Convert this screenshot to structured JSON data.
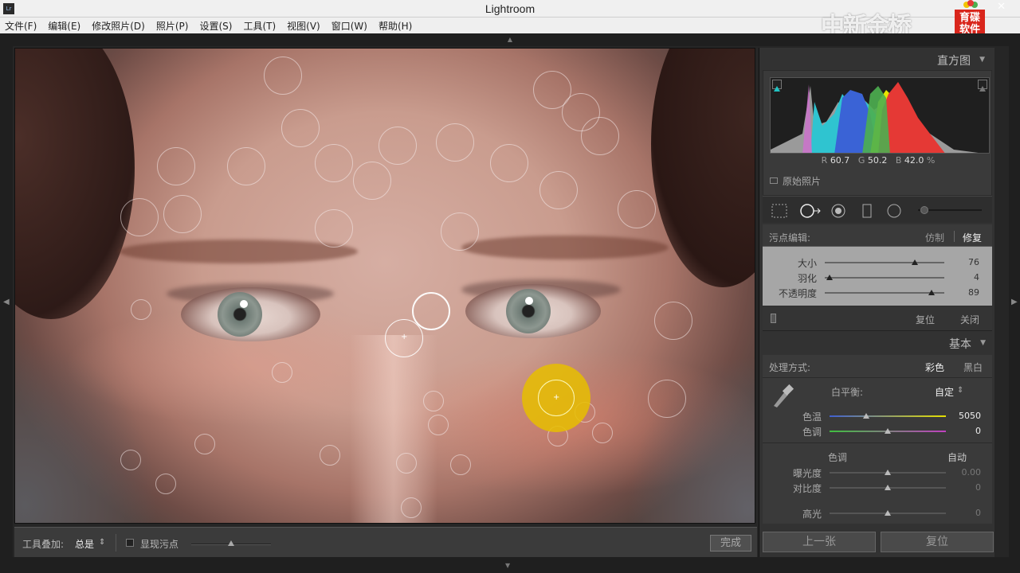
{
  "window": {
    "title": "Lightroom",
    "logo_text": "Lr",
    "close_glyph": "✕"
  },
  "menu": [
    "文件(F)",
    "编辑(E)",
    "修改照片(D)",
    "照片(P)",
    "设置(S)",
    "工具(T)",
    "视图(V)",
    "窗口(W)",
    "帮助(H)"
  ],
  "watermark": {
    "text": "中新金桥",
    "badge": "育碟软件"
  },
  "toolbar": {
    "overlay_label": "工具叠加:",
    "overlay_value": "总是",
    "overlay_arrow": "⇕",
    "show_spots_label": "显现污点",
    "done_label": "完成"
  },
  "histogram": {
    "title": "直方图",
    "r_label": "R",
    "r_value": "60.7",
    "g_label": "G",
    "g_value": "50.2",
    "b_label": "B",
    "b_value": "42.0",
    "unit": "%",
    "original_photo_label": "原始照片"
  },
  "spot_removal": {
    "label": "污点编辑:",
    "clone_label": "仿制",
    "heal_label": "修复",
    "size_label": "大小",
    "size_value": "76",
    "size_fraction": 0.75,
    "feather_label": "羽化",
    "feather_value": "4",
    "feather_fraction": 0.04,
    "opacity_label": "不透明度",
    "opacity_value": "89",
    "opacity_fraction": 0.89,
    "reset_label": "复位",
    "close_label": "关闭"
  },
  "basic": {
    "title": "基本",
    "treatment_label": "处理方式:",
    "color_label": "彩色",
    "bw_label": "黑白",
    "wb_label": "白平衡:",
    "wb_value": "自定",
    "wb_arrow": "⇕",
    "temp_label": "色温",
    "temp_value": "5050",
    "tint_label": "色调",
    "tint_value": "0",
    "tone_label": "色调",
    "auto_label": "自动",
    "exposure_label": "曝光度",
    "exposure_value": "0.00",
    "contrast_label": "对比度",
    "contrast_value": "0",
    "highlights_label": "高光",
    "highlights_value": "0"
  },
  "nav": {
    "prev_label": "上一张",
    "reset_label": "复位"
  },
  "colors": {
    "accent_yellow": "#e6be00",
    "panel_bg": "#323232",
    "spot_panel_bg": "#a6a6a6"
  }
}
